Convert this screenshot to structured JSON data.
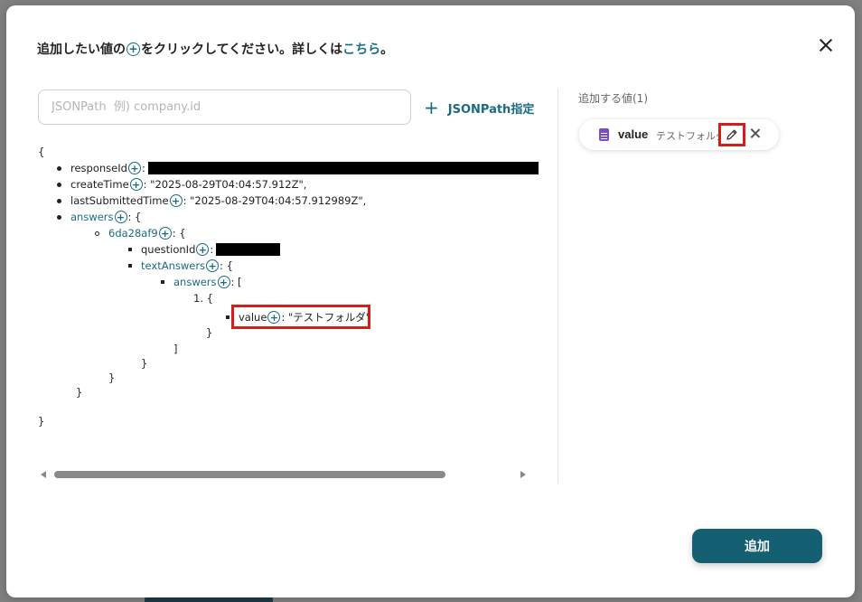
{
  "header": {
    "instruction_pre": "追加したい値の",
    "instruction_mid": "をクリックしてください。詳しくは",
    "instruction_link": "こちら",
    "instruction_end": "。"
  },
  "search": {
    "placeholder": "JSONPath  例) company.id",
    "add_jsonpath_label": "JSONPath指定"
  },
  "tree": {
    "open_brace": "{",
    "close_brace": "}",
    "responseId_key": "responseId",
    "createTime_key": "createTime",
    "createTime_value": ": \"2025-08-29T04:04:57.912Z\",",
    "lastSubmittedTime_key": "lastSubmittedTime",
    "lastSubmittedTime_value": ": \"2025-08-29T04:04:57.912989Z\",",
    "answers_key": "answers",
    "answers_suffix": ": {",
    "answer_id_key": "6da28af9",
    "answer_id_suffix": ": {",
    "questionId_key": "questionId",
    "textAnswers_key": "textAnswers",
    "textAnswers_suffix": ": {",
    "inner_answers_key": "answers",
    "inner_answers_suffix": ": [",
    "item_index": "1. {",
    "value_key": "value",
    "value_value": ": \"テストフォルダ\"",
    "colon": ":",
    "close_bracket": "]"
  },
  "right_panel": {
    "title": "追加する値(1)",
    "chip_name": "value",
    "chip_sub": "テストフォルダ"
  },
  "footer": {
    "add_button": "追加"
  },
  "colors": {
    "accent": "#1b6c82",
    "primary_button": "#145f72",
    "highlight": "#d81c1c",
    "doc_icon": "#7b4fc4"
  }
}
